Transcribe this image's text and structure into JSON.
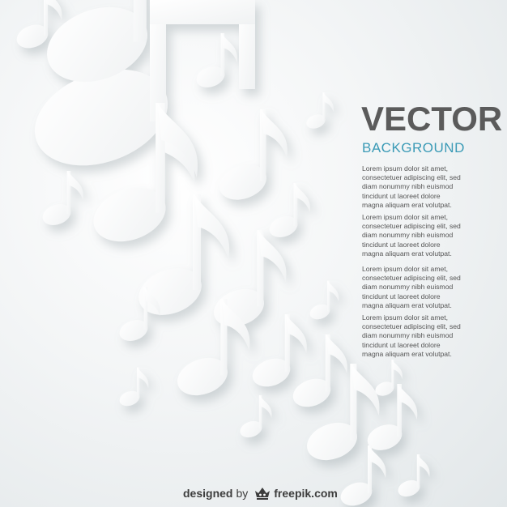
{
  "heading": {
    "title": "VECTOR",
    "subtitle": "BACKGROUND"
  },
  "paragraphs": [
    [
      "Lorem ipsum dolor sit amet,",
      "consectetuer adipiscing elit, sed",
      "diam nonummy nibh euismod",
      "tincidunt ut laoreet dolore",
      "magna aliquam erat volutpat."
    ],
    [
      "Lorem ipsum dolor sit amet,",
      "consectetuer adipiscing elit, sed",
      "diam nonummy nibh euismod",
      "tincidunt ut laoreet dolore",
      "magna aliquam erat volutpat."
    ],
    [
      "Lorem ipsum dolor sit amet,",
      "consectetuer adipiscing elit, sed",
      "diam nonummy nibh euismod",
      "tincidunt ut laoreet dolore",
      "magna aliquam erat volutpat."
    ],
    [
      "Lorem ipsum dolor sit amet,",
      "consectetuer adipiscing elit, sed",
      "diam nonummy nibh euismod",
      "tincidunt ut laoreet dolore",
      "magna aliquam erat volutpat."
    ]
  ],
  "credit": {
    "prefix": "designed",
    "by": "by",
    "brand": "freepik.com"
  },
  "colors": {
    "title": "#5b5b5b",
    "subtitle": "#3a9ab6",
    "body_text": "#555555",
    "background": "#eef1f2",
    "note_fill": "#ffffff"
  },
  "icons": [
    "music-note-icon",
    "beamed-notes-icon",
    "freepik-crown-icon"
  ]
}
